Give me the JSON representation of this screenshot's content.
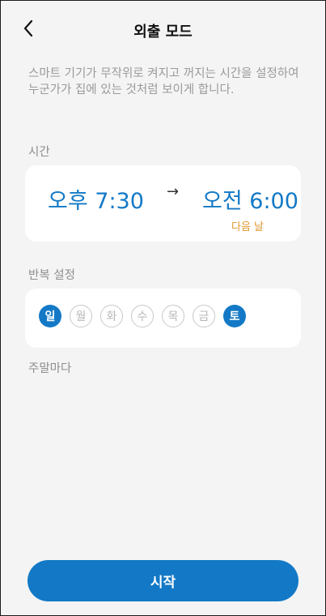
{
  "header": {
    "title": "외출 모드",
    "back_icon": "chevron-left-icon"
  },
  "description": "스마트 기기가 무작위로 켜지고 꺼지는 시간을 설정하여 누군가가 집에 있는 것처럼 보이게 합니다.",
  "time_section": {
    "label": "시간",
    "start_time": "오후 7:30",
    "arrow": "→",
    "end_time": "오전 6:00",
    "end_note": "다음 날"
  },
  "repeat_section": {
    "label": "반복 설정",
    "days": [
      {
        "label": "일",
        "selected": true
      },
      {
        "label": "월",
        "selected": false
      },
      {
        "label": "화",
        "selected": false
      },
      {
        "label": "수",
        "selected": false
      },
      {
        "label": "목",
        "selected": false
      },
      {
        "label": "금",
        "selected": false
      },
      {
        "label": "토",
        "selected": true
      }
    ],
    "summary": "주말마다"
  },
  "start_button": {
    "label": "시작"
  },
  "colors": {
    "accent": "#1379c6",
    "note": "#e0962e",
    "background": "#f4f4f4"
  }
}
